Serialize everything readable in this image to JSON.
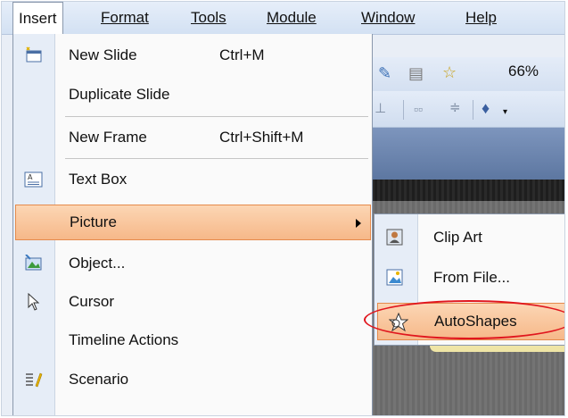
{
  "menubar": {
    "items": [
      {
        "label": "Insert"
      },
      {
        "label": "Format"
      },
      {
        "label": "Tools"
      },
      {
        "label": "Module"
      },
      {
        "label": "Window"
      },
      {
        "label": "Help"
      }
    ]
  },
  "toolbar": {
    "zoom": "66%"
  },
  "insert_menu": {
    "items": [
      {
        "label": "New Slide",
        "shortcut": "Ctrl+M",
        "icon": "new-slide-icon"
      },
      {
        "label": "Duplicate Slide"
      },
      {
        "label": "New Frame",
        "shortcut": "Ctrl+Shift+M"
      },
      {
        "label": "Text Box",
        "icon": "text-box-icon"
      },
      {
        "label": "Picture",
        "icon": "submenu-arrow-icon"
      },
      {
        "label": "Object...",
        "icon": "object-icon"
      },
      {
        "label": "Cursor",
        "icon": "cursor-icon"
      },
      {
        "label": "Timeline Actions"
      },
      {
        "label": "Scenario",
        "icon": "scenario-icon"
      }
    ]
  },
  "picture_submenu": {
    "items": [
      {
        "label": "Clip Art",
        "icon": "clip-art-icon"
      },
      {
        "label": "From File...",
        "icon": "from-file-icon"
      },
      {
        "label": "AutoShapes",
        "icon": "autoshapes-icon"
      }
    ]
  },
  "colors": {
    "highlight": "#f6b889",
    "highlight_border": "#e58a4c",
    "annotation": "#e0161e",
    "menubar": "#dbe6f5"
  }
}
